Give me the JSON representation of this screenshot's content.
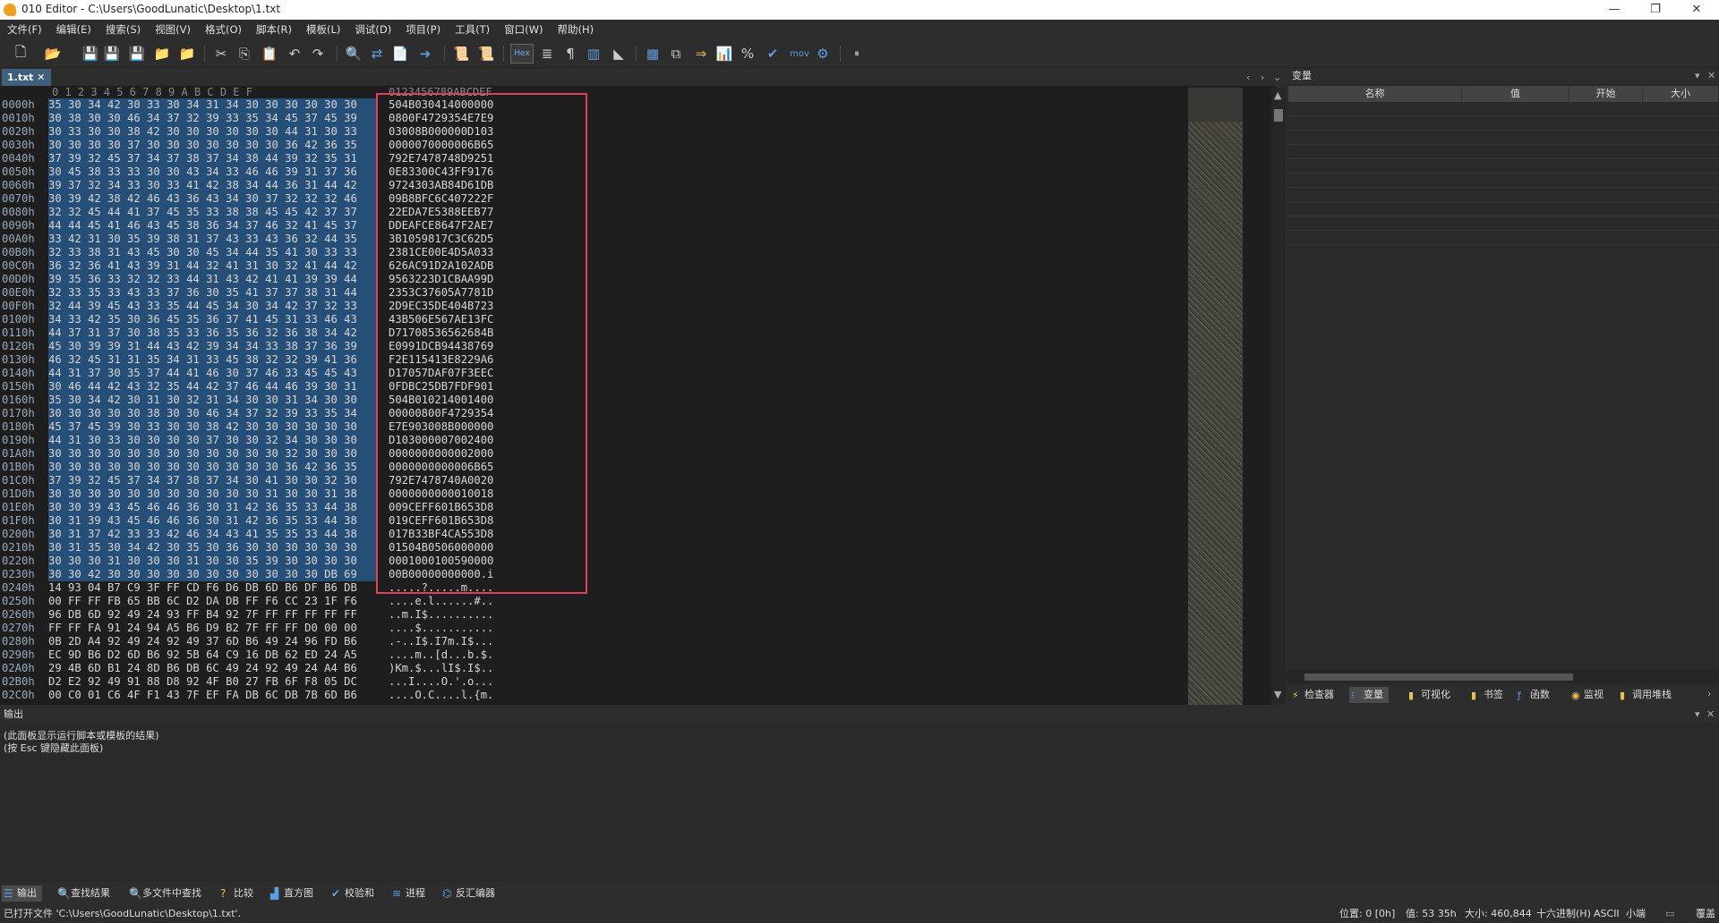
{
  "window": {
    "title": "010 Editor - C:\\Users\\GoodLunatic\\Desktop\\1.txt",
    "minimize": "—",
    "maximize": "❐",
    "close": "✕"
  },
  "menu": [
    "文件(F)",
    "编辑(E)",
    "搜索(S)",
    "视图(V)",
    "格式(O)",
    "脚本(R)",
    "模板(L)",
    "调试(D)",
    "项目(P)",
    "工具(T)",
    "窗口(W)",
    "帮助(H)"
  ],
  "toolbar": {
    "hex_label": "Hex",
    "mov_label": "mov"
  },
  "tab": {
    "label": "1.txt",
    "close": "✕"
  },
  "editor": {
    "column_header": "0  1  2  3  4  5  6  7  8  9  A  B  C  D  E  F",
    "ascii_header": "0123456789ABCDEF",
    "rows": [
      {
        "addr": "0000h",
        "hex": "35 30 34 42 30 33 30 34 31 34 30 30 30 30 30 30",
        "ascii": "504B030414000000"
      },
      {
        "addr": "0010h",
        "hex": "30 38 30 30 46 34 37 32 39 33 35 34 45 37 45 39",
        "ascii": "0800F4729354E7E9"
      },
      {
        "addr": "0020h",
        "hex": "30 33 30 30 38 42 30 30 30 30 30 30 44 31 30 33",
        "ascii": "03008B000000D103"
      },
      {
        "addr": "0030h",
        "hex": "30 30 30 30 37 30 30 30 30 30 30 30 36 42 36 35",
        "ascii": "0000070000006B65"
      },
      {
        "addr": "0040h",
        "hex": "37 39 32 45 37 34 37 38 37 34 38 44 39 32 35 31",
        "ascii": "792E7478748D9251"
      },
      {
        "addr": "0050h",
        "hex": "30 45 38 33 33 30 30 43 34 33 46 46 39 31 37 36",
        "ascii": "0E83300C43FF9176"
      },
      {
        "addr": "0060h",
        "hex": "39 37 32 34 33 30 33 41 42 38 34 44 36 31 44 42",
        "ascii": "9724303AB84D61DB"
      },
      {
        "addr": "0070h",
        "hex": "30 39 42 38 42 46 43 36 43 34 30 37 32 32 32 46",
        "ascii": "09B8BFC6C407222F"
      },
      {
        "addr": "0080h",
        "hex": "32 32 45 44 41 37 45 35 33 38 38 45 45 42 37 37",
        "ascii": "22EDA7E5388EEB77"
      },
      {
        "addr": "0090h",
        "hex": "44 44 45 41 46 43 45 38 36 34 37 46 32 41 45 37",
        "ascii": "DDEAFCE8647F2AE7"
      },
      {
        "addr": "00A0h",
        "hex": "33 42 31 30 35 39 38 31 37 43 33 43 36 32 44 35",
        "ascii": "3B1059817C3C62D5"
      },
      {
        "addr": "00B0h",
        "hex": "32 33 38 31 43 45 30 30 45 34 44 35 41 30 33 33",
        "ascii": "2381CE00E4D5A033"
      },
      {
        "addr": "00C0h",
        "hex": "36 32 36 41 43 39 31 44 32 41 31 30 32 41 44 42",
        "ascii": "626AC91D2A102ADB"
      },
      {
        "addr": "00D0h",
        "hex": "39 35 36 33 32 32 33 44 31 43 42 41 41 39 39 44",
        "ascii": "9563223D1CBAA99D"
      },
      {
        "addr": "00E0h",
        "hex": "32 33 35 33 43 33 37 36 30 35 41 37 37 38 31 44",
        "ascii": "2353C37605A7781D"
      },
      {
        "addr": "00F0h",
        "hex": "32 44 39 45 43 33 35 44 45 34 30 34 42 37 32 33",
        "ascii": "2D9EC35DE404B723"
      },
      {
        "addr": "0100h",
        "hex": "34 33 42 35 30 36 45 35 36 37 41 45 31 33 46 43",
        "ascii": "43B506E567AE13FC"
      },
      {
        "addr": "0110h",
        "hex": "44 37 31 37 30 38 35 33 36 35 36 32 36 38 34 42",
        "ascii": "D71708536562684B"
      },
      {
        "addr": "0120h",
        "hex": "45 30 39 39 31 44 43 42 39 34 34 33 38 37 36 39",
        "ascii": "E0991DCB94438769"
      },
      {
        "addr": "0130h",
        "hex": "46 32 45 31 31 35 34 31 33 45 38 32 32 39 41 36",
        "ascii": "F2E115413E8229A6"
      },
      {
        "addr": "0140h",
        "hex": "44 31 37 30 35 37 44 41 46 30 37 46 33 45 45 43",
        "ascii": "D17057DAF07F3EEC"
      },
      {
        "addr": "0150h",
        "hex": "30 46 44 42 43 32 35 44 42 37 46 44 46 39 30 31",
        "ascii": "0FDBC25DB7FDF901"
      },
      {
        "addr": "0160h",
        "hex": "35 30 34 42 30 31 30 32 31 34 30 30 31 34 30 30",
        "ascii": "504B010214001400"
      },
      {
        "addr": "0170h",
        "hex": "30 30 30 30 30 38 30 30 46 34 37 32 39 33 35 34",
        "ascii": "00000800F4729354"
      },
      {
        "addr": "0180h",
        "hex": "45 37 45 39 30 33 30 30 38 42 30 30 30 30 30 30",
        "ascii": "E7E903008B000000"
      },
      {
        "addr": "0190h",
        "hex": "44 31 30 33 30 30 30 30 37 30 30 32 34 30 30 30",
        "ascii": "D103000007002400"
      },
      {
        "addr": "01A0h",
        "hex": "30 30 30 30 30 30 30 30 30 30 30 30 32 30 30 30",
        "ascii": "0000000000002000"
      },
      {
        "addr": "01B0h",
        "hex": "30 30 30 30 30 30 30 30 30 30 30 30 36 42 36 35",
        "ascii": "0000000000006B65"
      },
      {
        "addr": "01C0h",
        "hex": "37 39 32 45 37 34 37 38 37 34 30 41 30 30 32 30",
        "ascii": "792E7478740A0020"
      },
      {
        "addr": "01D0h",
        "hex": "30 30 30 30 30 30 30 30 30 30 30 31 30 30 31 38",
        "ascii": "0000000000010018"
      },
      {
        "addr": "01E0h",
        "hex": "30 30 39 43 45 46 46 36 30 31 42 36 35 33 44 38",
        "ascii": "009CEFF601B653D8"
      },
      {
        "addr": "01F0h",
        "hex": "30 31 39 43 45 46 46 36 30 31 42 36 35 33 44 38",
        "ascii": "019CEFF601B653D8"
      },
      {
        "addr": "0200h",
        "hex": "30 31 37 42 33 33 42 46 34 43 41 35 35 33 44 38",
        "ascii": "017B33BF4CA553D8"
      },
      {
        "addr": "0210h",
        "hex": "30 31 35 30 34 42 30 35 30 36 30 30 30 30 30 30",
        "ascii": "01504B0506000000"
      },
      {
        "addr": "0220h",
        "hex": "30 30 30 31 30 30 30 31 30 30 35 39 30 30 30 30",
        "ascii": "0001000100590000"
      },
      {
        "addr": "0230h",
        "hex": "30 30 42 30 30 30 30 30 30 30 30 30 30 30 DB 69",
        "ascii": "00B00000000000.i"
      },
      {
        "addr": "0240h",
        "hex": "14 93 04 B7 C9 3F FF CD F6 D6 DB 6D B6 DF B6 DB",
        "ascii": ".....?.....m...."
      },
      {
        "addr": "0250h",
        "hex": "00 FF FF FB 65 BB 6C D2 DA DB FF F6 CC 23 1F F6",
        "ascii": "....e.l......#.."
      },
      {
        "addr": "0260h",
        "hex": "96 DB 6D 92 49 24 93 FF B4 92 7F FF FF FF FF FF",
        "ascii": "..m.I$.........."
      },
      {
        "addr": "0270h",
        "hex": "FF FF FA 91 24 94 A5 B6 D9 B2 7F FF FF D0 00 00",
        "ascii": "....$..........."
      },
      {
        "addr": "0280h",
        "hex": "0B 2D A4 92 49 24 92 49 37 6D B6 49 24 96 FD B6",
        "ascii": ".-..I$.I7m.I$..."
      },
      {
        "addr": "0290h",
        "hex": "EC 9D B6 D2 6D B6 92 5B 64 C9 16 DB 62 ED 24 A5",
        "ascii": "....m..[d...b.$."
      },
      {
        "addr": "02A0h",
        "hex": "29 4B 6D B1 24 8D B6 DB 6C 49 24 92 49 24 A4 B6",
        "ascii": ")Km.$...lI$.I$.."
      },
      {
        "addr": "02B0h",
        "hex": "D2 E2 92 49 91 88 D8 92 4F B0 27 FB 6F F8 05 DC",
        "ascii": "...I....O.'.o..."
      },
      {
        "addr": "02C0h",
        "hex": "00 C0 01 C6 4F F1 43 7F EF FA DB 6C DB 7B 6D B6",
        "ascii": "....O.C....l.{m."
      }
    ]
  },
  "variables_panel": {
    "title": "变量",
    "columns": [
      "名称",
      "值",
      "开始",
      "大小"
    ],
    "tabs": [
      "检查器",
      "变量",
      "可视化",
      "书签",
      "函数",
      "监视",
      "调用堆栈"
    ]
  },
  "output_panel": {
    "title": "输出",
    "lines": [
      "(此面板显示运行脚本或模板的结果)",
      "(按 Esc 键隐藏此面板)"
    ]
  },
  "bottom_tabs": [
    "输出",
    "查找结果",
    "多文件中查找",
    "比较",
    "直方图",
    "校验和",
    "进程",
    "反汇编器"
  ],
  "status": {
    "left": "已打开文件 'C:\\Users\\GoodLunatic\\Desktop\\1.txt'.",
    "position": "位置: 0 [0h]",
    "value": "值: 53 35h",
    "size": "大小: 460,844",
    "base": "十六进制(H)",
    "encoding": "ASCII",
    "endian": "小端",
    "mode": "覆盖"
  },
  "colors": {
    "highlight_box": "#e0405a",
    "selection": "#264f78",
    "tab_active": "#3f5f7f"
  }
}
